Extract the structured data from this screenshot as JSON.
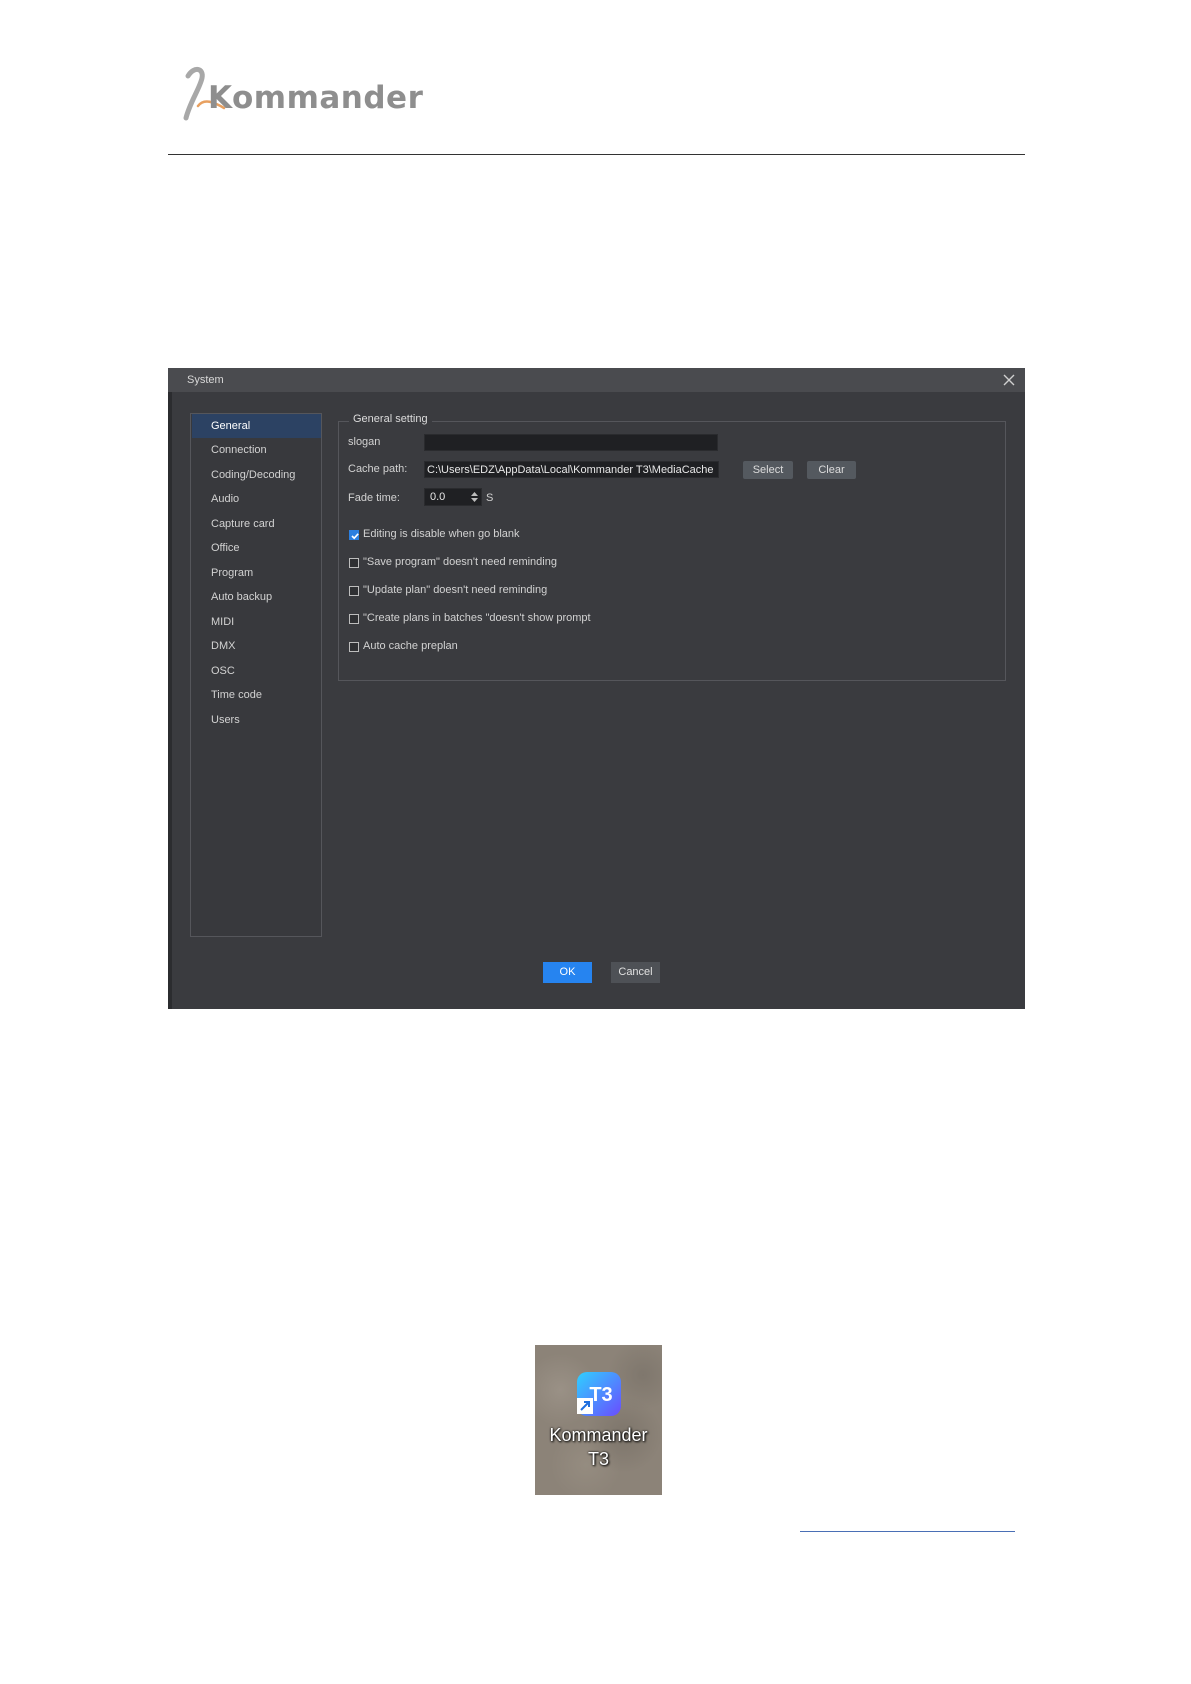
{
  "header": {
    "logo_text": "Kommander"
  },
  "dialog": {
    "title": "System",
    "nav_items": [
      {
        "label": "General",
        "active": true
      },
      {
        "label": "Connection"
      },
      {
        "label": "Coding/Decoding"
      },
      {
        "label": "Audio"
      },
      {
        "label": "Capture card"
      },
      {
        "label": "Office"
      },
      {
        "label": "Program"
      },
      {
        "label": "Auto backup"
      },
      {
        "label": "MIDI"
      },
      {
        "label": "DMX"
      },
      {
        "label": "OSC"
      },
      {
        "label": "Time code"
      },
      {
        "label": "Users"
      }
    ],
    "group_title": "General setting",
    "slogan_label": "slogan",
    "slogan_value": "",
    "cache_label": "Cache path:",
    "cache_value": "C:\\Users\\EDZ\\AppData\\Local\\Kommander T3\\MediaCache",
    "select_label": "Select",
    "clear_label": "Clear",
    "fade_label": "Fade time:",
    "fade_value": "0.0",
    "fade_unit": "S",
    "checkboxes": [
      {
        "label": "Editing is disable when go blank",
        "checked": true
      },
      {
        "label": "\"Save program\" doesn't need reminding",
        "checked": false
      },
      {
        "label": "\"Update plan\" doesn't need reminding",
        "checked": false
      },
      {
        "label": "\"Create plans in batches \"doesn't show prompt",
        "checked": false
      },
      {
        "label": "Auto cache preplan",
        "checked": false
      }
    ],
    "ok_label": "OK",
    "cancel_label": "Cancel"
  },
  "desktop_icon": {
    "icon_text": "T3",
    "label_line1": "Kommander",
    "label_line2": "T3"
  },
  "colors": {
    "accent": "#2684f0",
    "dialog_bg": "#3a3b3f",
    "nav_active": "#2c4263"
  }
}
